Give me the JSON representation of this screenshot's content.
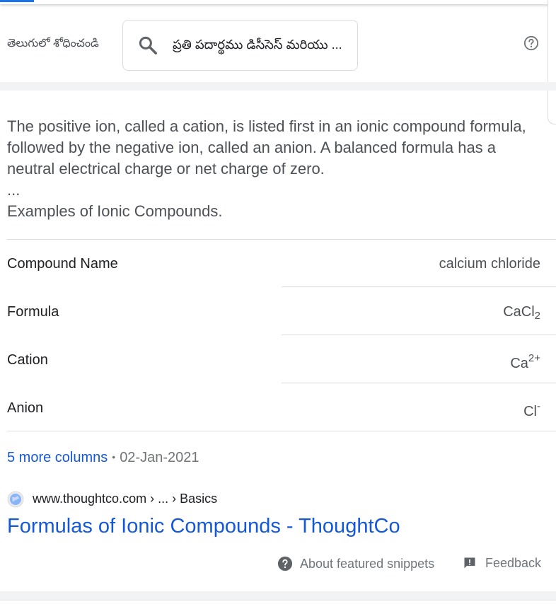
{
  "search": {
    "label": "తెలుగులో శోధించండి",
    "query": "ప్రతి పదార్థము డిసీసెస్ మరియు ..."
  },
  "snippet": {
    "text": "The positive ion, called a cation, is listed first in an ionic compound formula, followed by the negative ion, called an anion. A balanced formula has a neutral electrical charge or net charge of zero.",
    "ellipsis": "...",
    "subheading": "Examples of Ionic Compounds."
  },
  "table": {
    "rows": [
      {
        "key": "Compound Name",
        "value": "calcium chloride"
      },
      {
        "key": "Formula",
        "value_main": "CaCl",
        "value_sub": "2"
      },
      {
        "key": "Cation",
        "value_main": "Ca",
        "value_sup": "2+"
      },
      {
        "key": "Anion",
        "value_main": "Cl",
        "value_sup": "-"
      }
    ]
  },
  "more": {
    "link": "5 more columns",
    "date": "02-Jan-2021"
  },
  "result": {
    "breadcrumb": "www.thoughtco.com › ... › Basics",
    "title": "Formulas of Ionic Compounds - ThoughtCo"
  },
  "footer": {
    "about": "About featured snippets",
    "feedback": "Feedback"
  },
  "colors": {
    "link": "#1558d6",
    "accent": "#1a73e8",
    "band": "#f1f3f4"
  }
}
